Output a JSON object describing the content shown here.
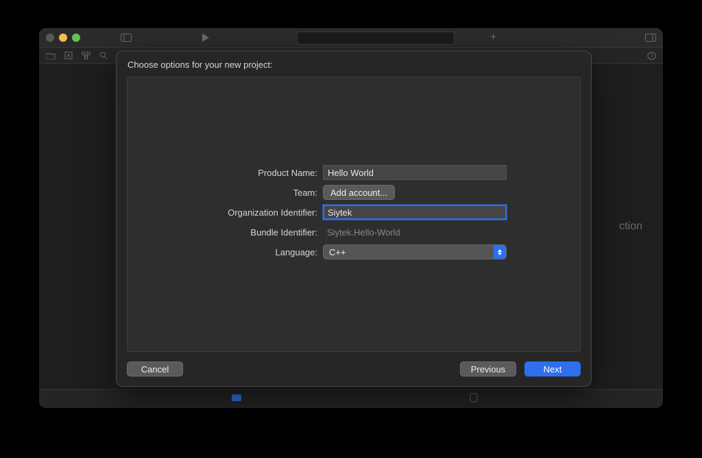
{
  "bg": {
    "no_selection": "ction"
  },
  "sheet": {
    "title": "Choose options for your new project:",
    "labels": {
      "product_name": "Product Name:",
      "team": "Team:",
      "org_identifier": "Organization Identifier:",
      "bundle_identifier": "Bundle Identifier:",
      "language": "Language:"
    },
    "values": {
      "product_name": "Hello World",
      "team_button": "Add account...",
      "org_identifier": "Siytek",
      "bundle_identifier": "Siytek.Hello-World",
      "language": "C++"
    },
    "buttons": {
      "cancel": "Cancel",
      "previous": "Previous",
      "next": "Next"
    }
  }
}
